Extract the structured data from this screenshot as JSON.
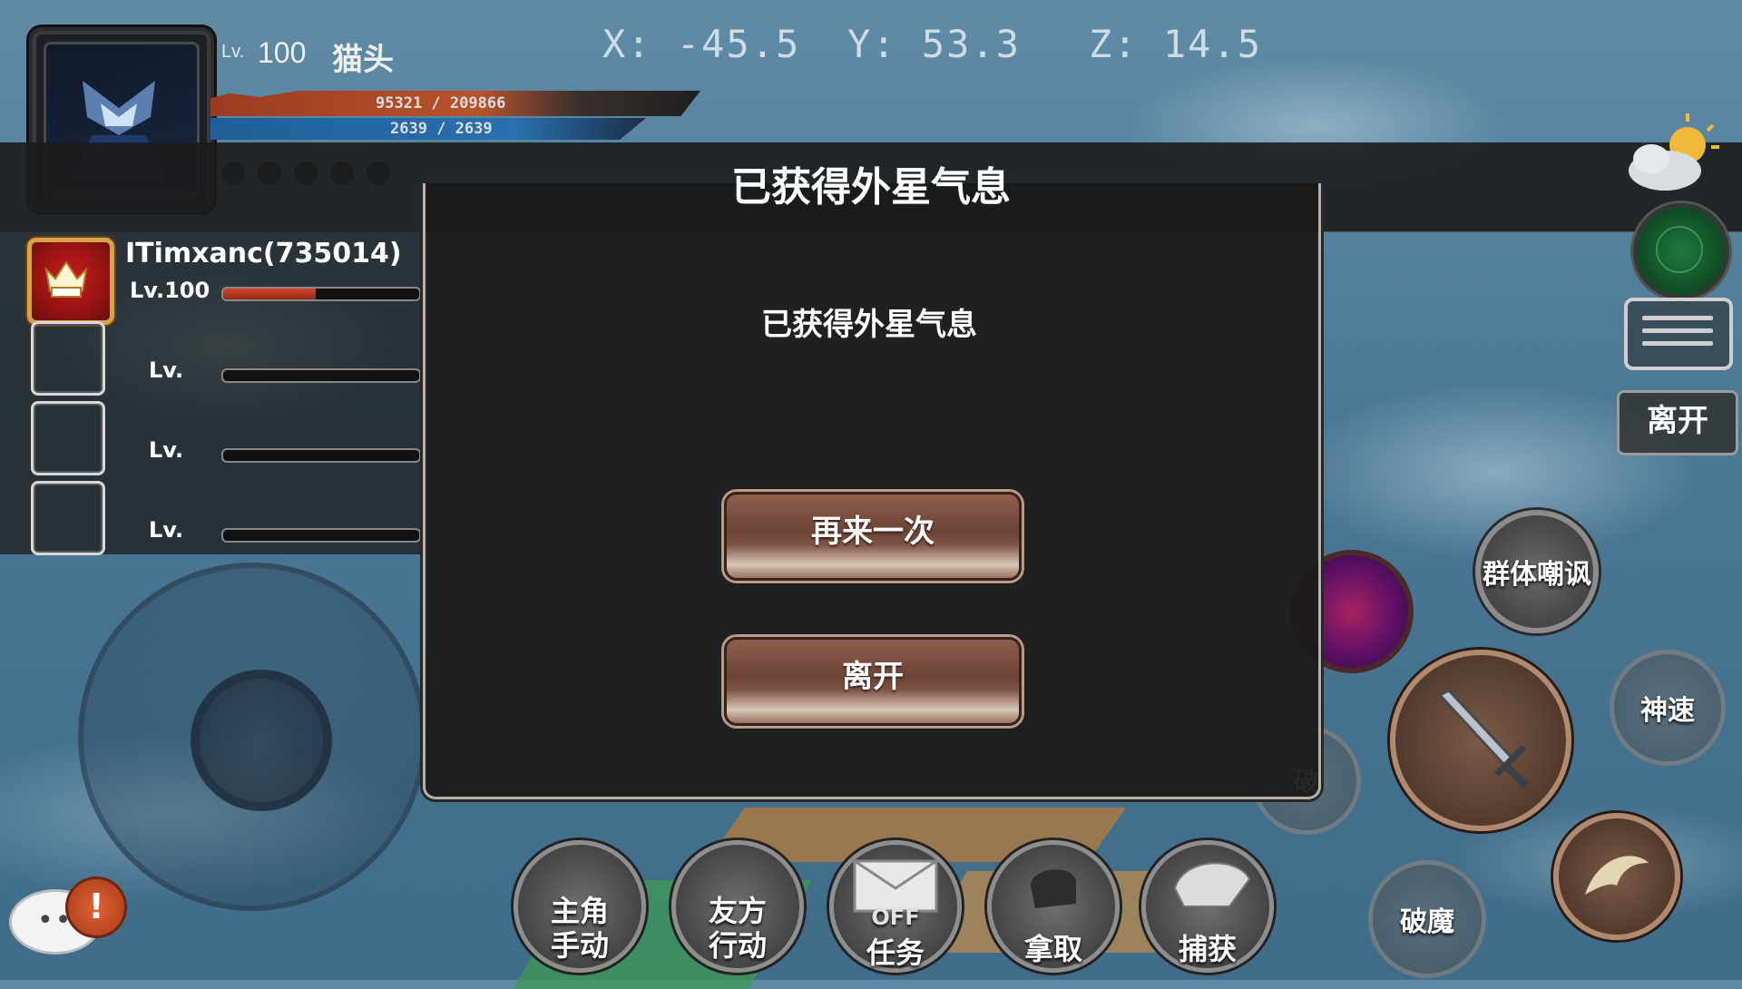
{
  "player": {
    "level_label": "Lv.",
    "level": "100",
    "name": "猫头",
    "hp": "95321",
    "hp_max": "209866",
    "mp": "2639",
    "mp_max": "2639"
  },
  "coords": {
    "x": "X: -45.5",
    "y": "Y: 53.3",
    "z": "Z: 14.5"
  },
  "banner": {
    "title": "已获得外星气息"
  },
  "party": {
    "leader": {
      "name": "ITimxanc(735014)",
      "level": "Lv.100",
      "hp_fraction": 0.47
    },
    "slots": [
      {
        "level": "Lv."
      },
      {
        "level": "Lv."
      },
      {
        "level": "Lv."
      }
    ]
  },
  "dialog": {
    "message": "已获得外星气息",
    "retry_label": "再来一次",
    "leave_label": "离开"
  },
  "right_panel": {
    "leave_label": "离开"
  },
  "skills": {
    "taunt": "群体嘲讽",
    "speed": "神速",
    "break_magic": "破魔",
    "break_faded": "破"
  },
  "bottom_bar": {
    "hero_manual": [
      "主角",
      "手动"
    ],
    "ally_action": [
      "友方",
      "行动"
    ],
    "quest": {
      "badge": "OFF",
      "label": "任务"
    },
    "take": "拿取",
    "capture": "捕获"
  },
  "chat": {
    "alert": "!"
  },
  "colors": {
    "hp": "#b7532c",
    "mp": "#2a6fb0",
    "button": "#7d5444"
  }
}
